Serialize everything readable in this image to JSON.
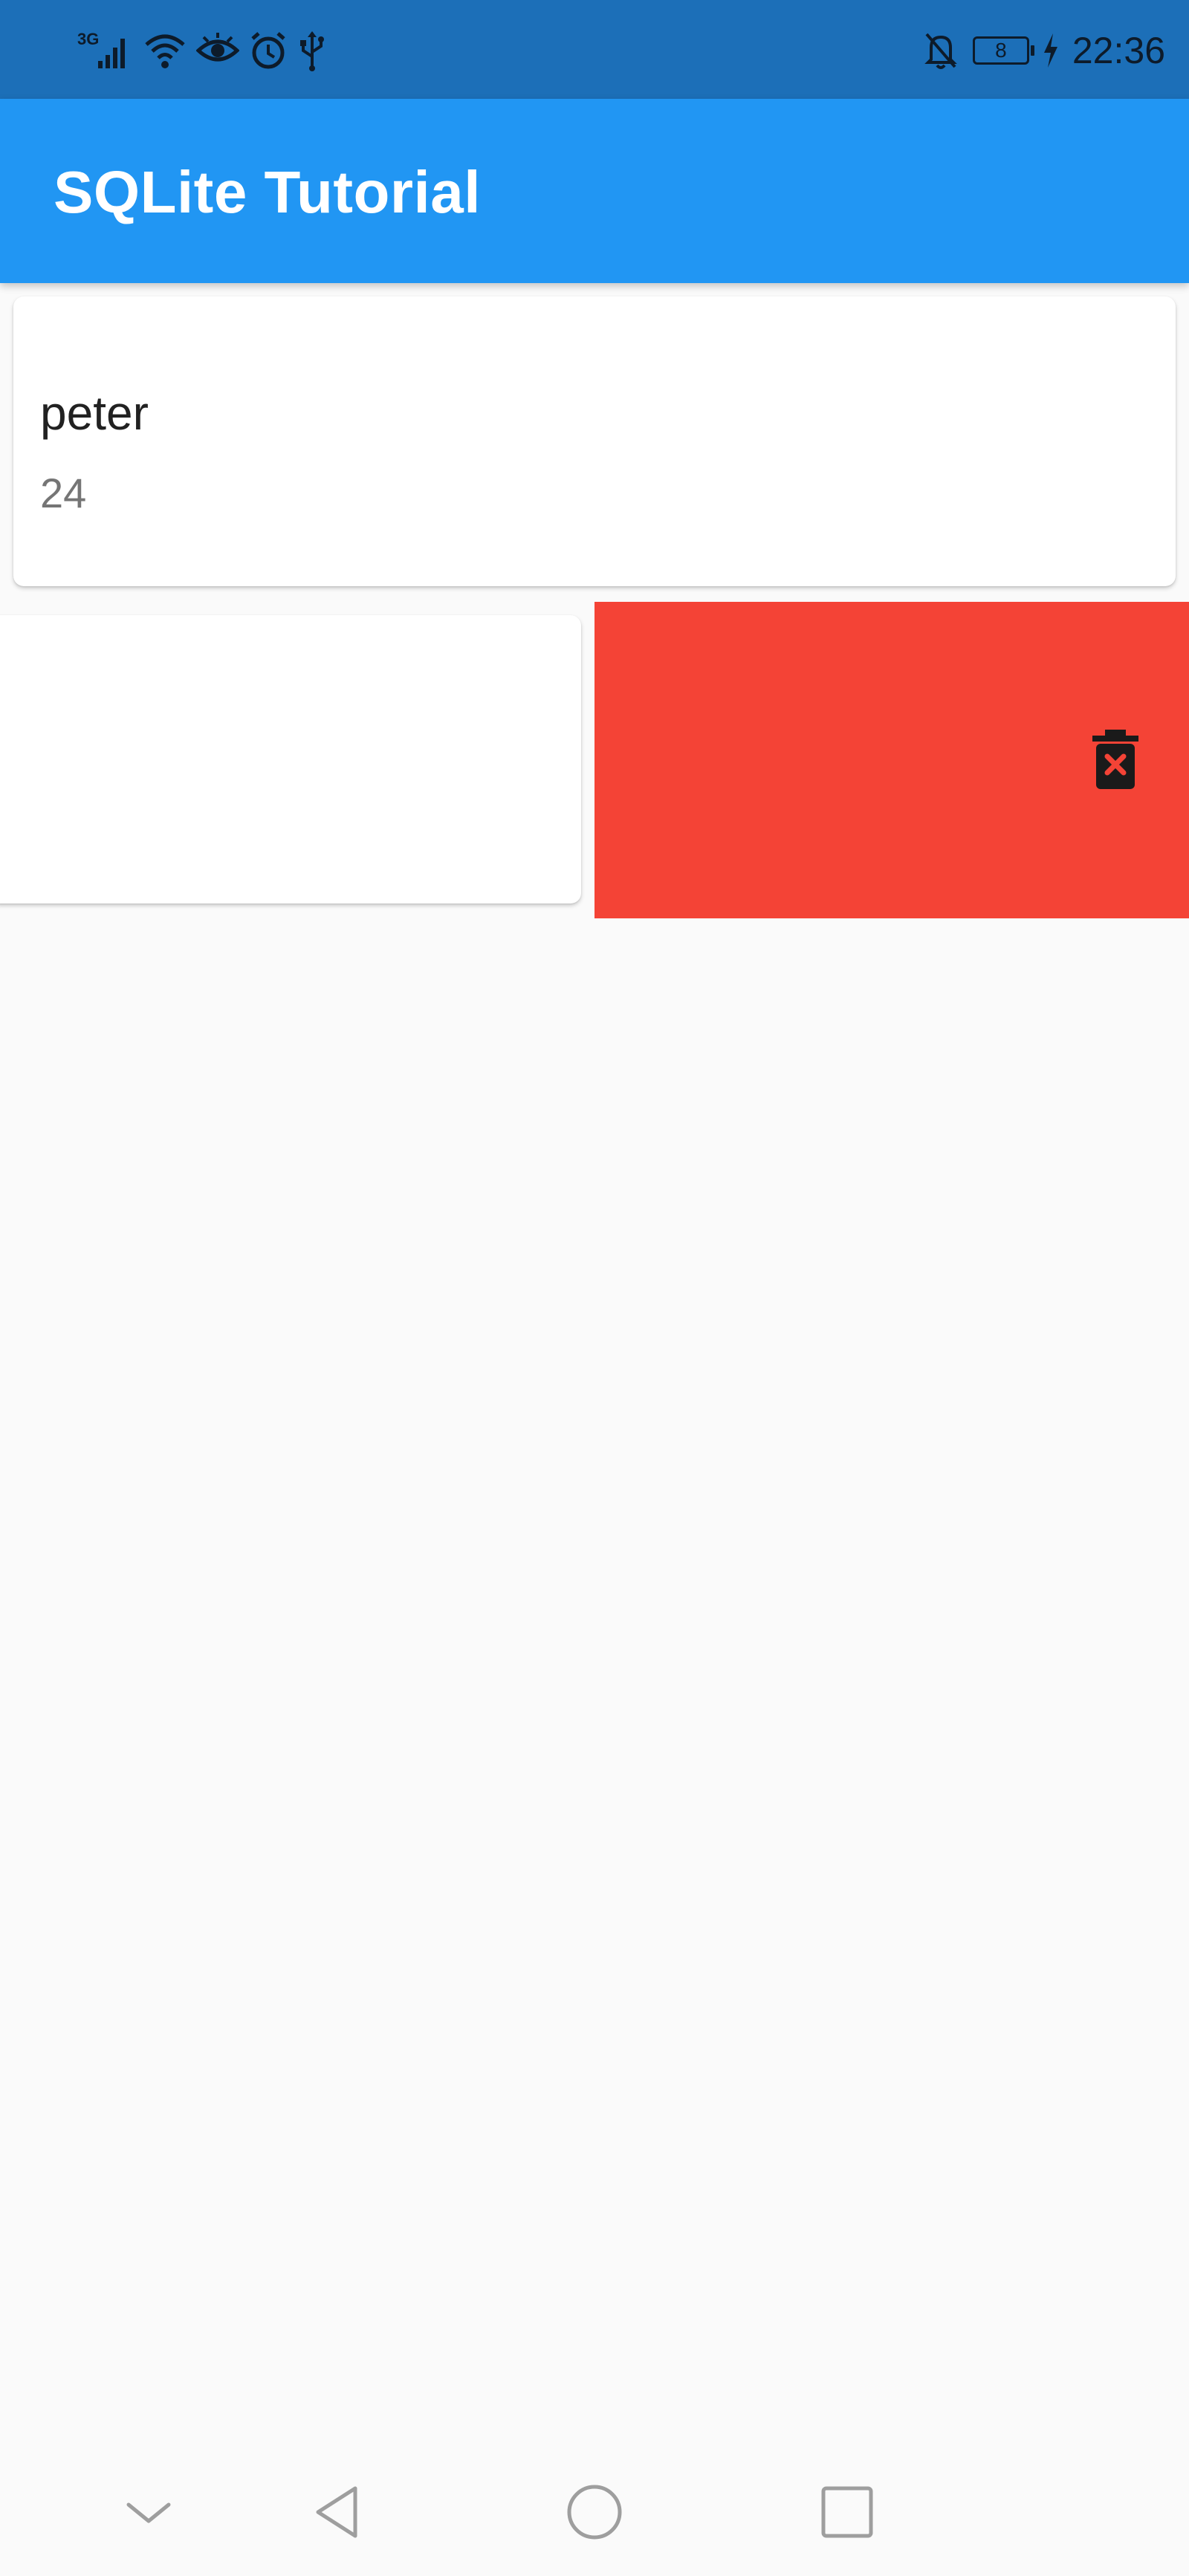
{
  "status_bar": {
    "network": "3G",
    "time": "22:36",
    "battery_level": "8",
    "icons": [
      "signal-icon",
      "wifi-icon",
      "eye-icon",
      "alarm-icon",
      "usb-icon",
      "notifications-off-icon",
      "battery-icon",
      "charging-icon"
    ]
  },
  "app_bar": {
    "title": "SQLite Tutorial"
  },
  "list": {
    "items": [
      {
        "name": "peter",
        "age": "24"
      }
    ],
    "swipe_action": {
      "icon": "delete-forever-icon",
      "background_color": "#f44336"
    }
  },
  "nav_bar": {
    "buttons": [
      "hide-nav-icon",
      "back-icon",
      "home-icon",
      "recents-icon"
    ]
  },
  "colors": {
    "status_bar": "#1c6fb8",
    "app_bar": "#2196f3",
    "background": "#fafafa",
    "delete": "#f44336"
  }
}
